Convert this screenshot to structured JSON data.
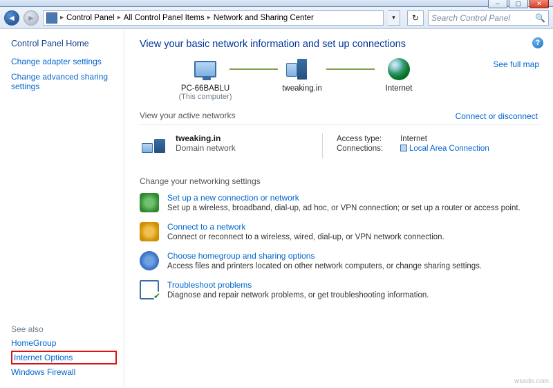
{
  "window": {
    "min_label": "–",
    "max_label": "▢",
    "close_label": "✕"
  },
  "nav": {
    "back_glyph": "◄",
    "fwd_glyph": "►",
    "crumb1": "Control Panel",
    "crumb2": "All Control Panel Items",
    "crumb3": "Network and Sharing Center",
    "sep": "▸",
    "refresh_glyph": "↻",
    "search_placeholder": "Search Control Panel"
  },
  "sidebar": {
    "home": "Control Panel Home",
    "link1": "Change adapter settings",
    "link2": "Change advanced sharing settings",
    "seealso_title": "See also",
    "sa1": "HomeGroup",
    "sa2": "Internet Options",
    "sa3": "Windows Firewall"
  },
  "main": {
    "help": "?",
    "title": "View your basic network information and set up connections",
    "map_link": "See full map",
    "node1_label": "PC-66BABLU",
    "node1_sub": "(This computer)",
    "node2_label": "tweaking.in",
    "node3_label": "Internet",
    "active_label": "View your active networks",
    "conn_link": "Connect or disconnect",
    "network_name": "tweaking.in",
    "network_type": "Domain network",
    "access_lbl": "Access type:",
    "access_val": "Internet",
    "conn_lbl": "Connections:",
    "conn_val": "Local Area Connection",
    "change_label": "Change your networking settings",
    "tasks": [
      {
        "title": "Set up a new connection or network",
        "desc": "Set up a wireless, broadband, dial-up, ad hoc, or VPN connection; or set up a router or access point."
      },
      {
        "title": "Connect to a network",
        "desc": "Connect or reconnect to a wireless, wired, dial-up, or VPN network connection."
      },
      {
        "title": "Choose homegroup and sharing options",
        "desc": "Access files and printers located on other network computers, or change sharing settings."
      },
      {
        "title": "Troubleshoot problems",
        "desc": "Diagnose and repair network problems, or get troubleshooting information."
      }
    ]
  },
  "watermark": "wsxdn.com"
}
